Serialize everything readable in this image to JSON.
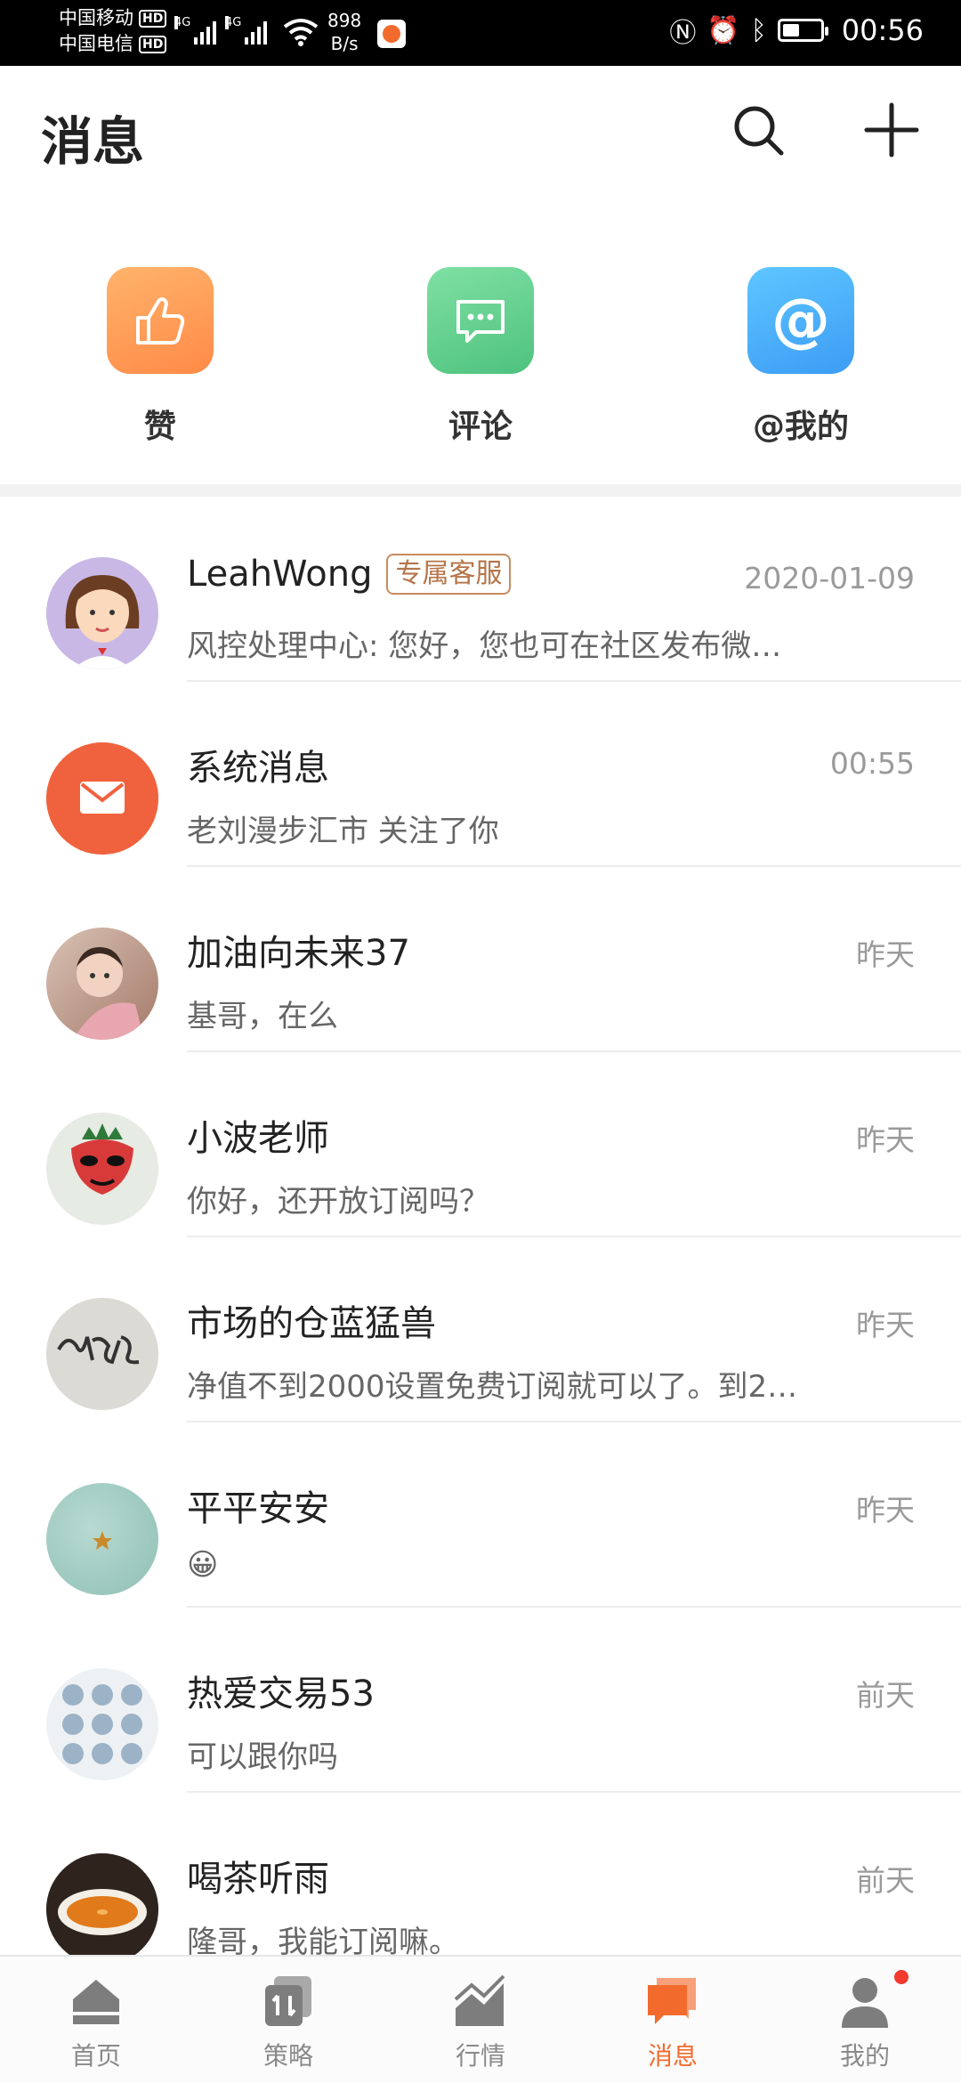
{
  "status_bar": {
    "carrier_1": "中国移动",
    "carrier_2": "中国电信",
    "hd_label": "HD",
    "network_1": "4G",
    "network_2": "4G",
    "net_speed_value": "898",
    "net_speed_unit": "B/s",
    "time": "00:56",
    "battery_level": 0.45
  },
  "header": {
    "title": "消息"
  },
  "shortcuts": [
    {
      "label": "赞",
      "icon": "thumbs-up-icon",
      "color_from": "#ffb36b",
      "color_to": "#ff8a47"
    },
    {
      "label": "评论",
      "icon": "comment-icon",
      "color_from": "#7fe0a3",
      "color_to": "#4ec27e"
    },
    {
      "label": "@我的",
      "icon": "at-icon",
      "color_from": "#5ec6ff",
      "color_to": "#3d9cf5"
    }
  ],
  "messages": [
    {
      "name": "LeahWong",
      "badge": "专属客服",
      "time": "2020-01-09",
      "preview": "风控处理中心: 您好，您也可在社区发布微…",
      "avatar": "cartoon-woman-avatar"
    },
    {
      "name": "系统消息",
      "time": "00:55",
      "preview": "老刘漫步汇市 关注了你",
      "avatar": "mail-avatar"
    },
    {
      "name": "加油向未来37",
      "time": "昨天",
      "preview": "基哥，在么",
      "avatar": "baby-photo-avatar"
    },
    {
      "name": "小波老师",
      "time": "昨天",
      "preview": "你好，还开放订阅吗？",
      "avatar": "opera-mask-avatar"
    },
    {
      "name": "市场的仓蓝猛兽",
      "time": "昨天",
      "preview": "净值不到2000设置免费订阅就可以了。到2…",
      "avatar": "calligraphy-avatar"
    },
    {
      "name": "平平安安",
      "time": "昨天",
      "preview": "😀",
      "avatar": "teal-star-avatar"
    },
    {
      "name": "热爱交易53",
      "time": "前天",
      "preview": "可以跟你吗",
      "avatar": "pattern-grid-avatar"
    },
    {
      "name": "喝茶听雨",
      "time": "前天",
      "preview": "隆哥，我能订阅嘛。",
      "avatar": "tea-cup-avatar"
    }
  ],
  "tabbar": [
    {
      "label": "首页",
      "icon": "home-icon",
      "active": false
    },
    {
      "label": "策略",
      "icon": "strategy-icon",
      "active": false
    },
    {
      "label": "行情",
      "icon": "market-chart-icon",
      "active": false
    },
    {
      "label": "消息",
      "icon": "message-bubbles-icon",
      "active": true
    },
    {
      "label": "我的",
      "icon": "profile-icon",
      "active": false
    }
  ],
  "colors": {
    "accent": "#f26b2d",
    "badge_text": "#b5754a",
    "notification_dot": "#f23a2d"
  }
}
